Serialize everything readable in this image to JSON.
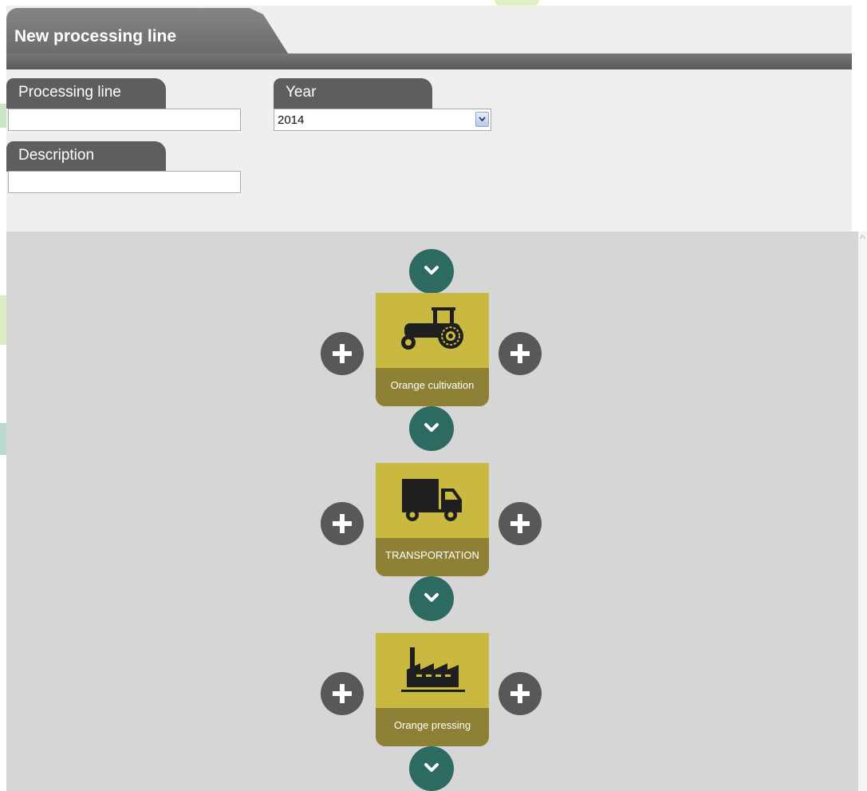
{
  "form": {
    "title": "New processing line",
    "processing_line": {
      "label": "Processing line",
      "value": "",
      "placeholder": ""
    },
    "year": {
      "label": "Year",
      "selected": "2014"
    },
    "description": {
      "label": "Description",
      "value": "",
      "placeholder": ""
    }
  },
  "steps": [
    {
      "label": "Orange cultivation",
      "icon": "tractor-icon"
    },
    {
      "label": "TRANSPORTATION",
      "icon": "truck-icon"
    },
    {
      "label": "Orange pressing",
      "icon": "factory-icon"
    }
  ],
  "colors": {
    "header": "#6e6e6e",
    "field_tab": "#5e5e5e",
    "panel_bg": "#efefef",
    "canvas_bg": "#d6d6d6",
    "connector": "#2d6b62",
    "step_card": "#c9b941",
    "step_label_bg": "#8e8035",
    "add_button": "#585858"
  }
}
